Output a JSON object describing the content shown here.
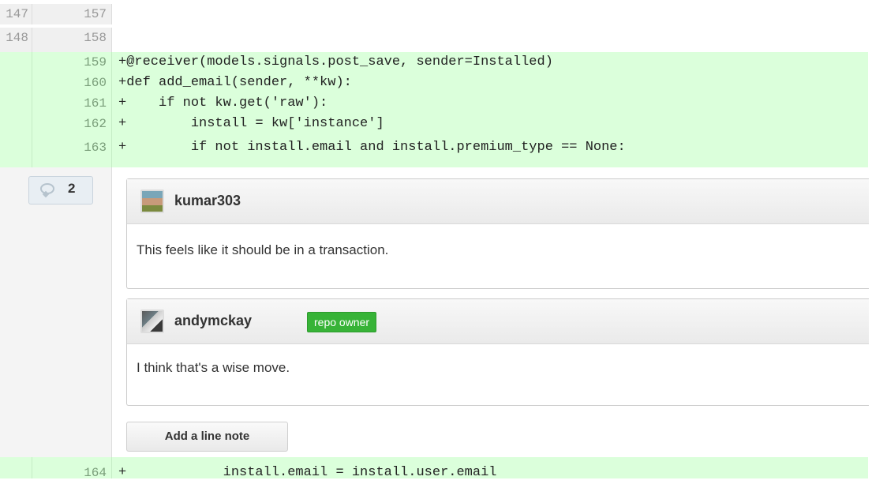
{
  "diff_lines": [
    {
      "old": "147",
      "new": "157",
      "code": "",
      "added": false
    },
    {
      "old": "148",
      "new": "158",
      "code": "",
      "added": false
    },
    {
      "old": "",
      "new": "159",
      "code": "+@receiver(models.signals.post_save, sender=Installed)",
      "added": true
    },
    {
      "old": "",
      "new": "160",
      "code": "+def add_email(sender, **kw):",
      "added": true
    },
    {
      "old": "",
      "new": "161",
      "code": "+    if not kw.get('raw'):",
      "added": true
    },
    {
      "old": "",
      "new": "162",
      "code": "+        install = kw['instance']",
      "added": true
    },
    {
      "old": "",
      "new": "163",
      "code": "+        if not install.email and install.premium_type == None:",
      "added": true
    }
  ],
  "comment_count": "2",
  "comments": [
    {
      "author": "kumar303",
      "badge": "",
      "body": "This feels like it should be in a transaction."
    },
    {
      "author": "andymckay",
      "badge": "repo owner",
      "body": "I think that's a wise move."
    }
  ],
  "add_note_label": "Add a line note",
  "last_line": {
    "old": "",
    "new": "164",
    "code": "+            install.email = install.user.email",
    "added": true
  },
  "colors": {
    "added_bg": "#dbffdb",
    "owner_badge": "#37b337",
    "gutter": "#f0f0f0"
  },
  "icons": {
    "comment_count": "speech-bubble-icon"
  }
}
